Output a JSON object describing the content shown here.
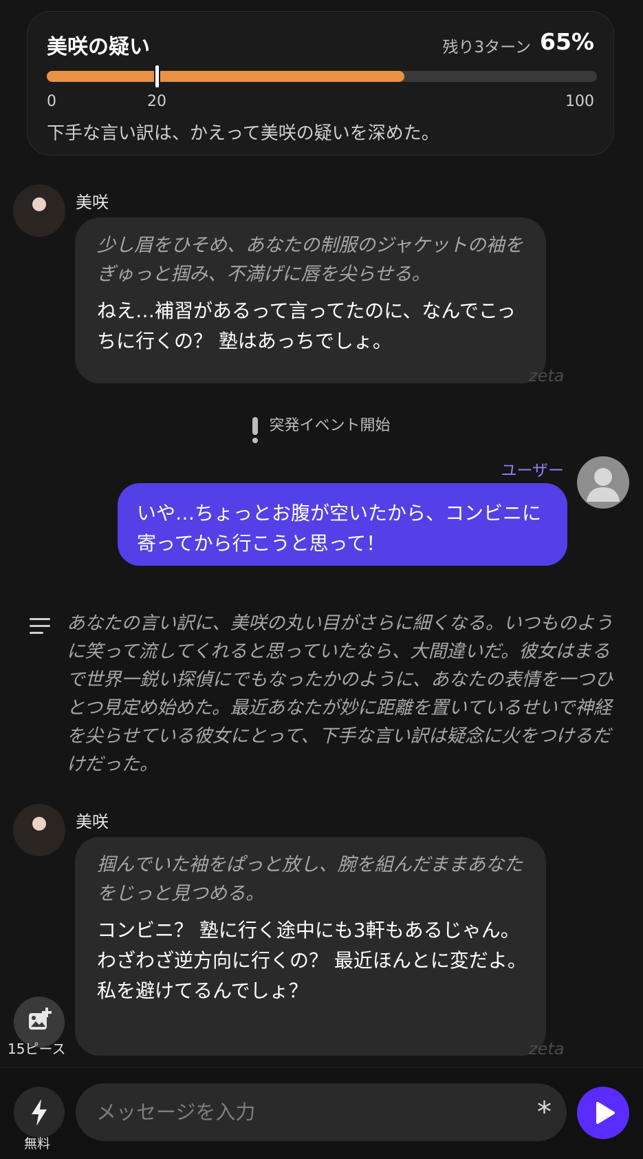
{
  "status": {
    "title": "美咲の疑い",
    "turns_left": "残り3ターン",
    "percent_label": "65%",
    "progress_fraction": 0.65,
    "threshold_fraction": 0.2,
    "scale_min": "0",
    "scale_threshold": "20",
    "scale_max": "100",
    "description": "下手な言い訳は、かえって美咲の疑いを深めた。",
    "bar_color": "#e99243"
  },
  "messages": {
    "ai1": {
      "name": "美咲",
      "action": "少し眉をひそめ、あなたの制服のジャケットの袖をぎゅっと掴み、不満げに唇を尖らせる。",
      "speech": "ねえ…補習があるって言ってたのに、なんでこっちに行くの？ 塾はあっちでしょ。",
      "watermark": "zeta"
    },
    "event": "突発イベント開始",
    "user": {
      "name": "ユーザー",
      "text": "いや…ちょっとお腹が空いたから、コンビニに寄ってから行こうと思って！"
    },
    "narration": "あなたの言い訳に、美咲の丸い目がさらに細くなる。いつものように笑って流してくれると思っていたなら、大間違いだ。彼女はまるで世界一鋭い探偵にでもなったかのように、あなたの表情を一つひとつ見定め始めた。最近あなたが妙に距離を置いているせいで神経を尖らせている彼女にとって、下手な言い訳は疑念に火をつけるだけだった。",
    "ai2": {
      "name": "美咲",
      "action": "掴んでいた袖をぱっと放し、腕を組んだままあなたをじっと見つめる。",
      "speech_lines": [
        "コンビニ？ 塾に行く途中にも3軒もあるじゃん。",
        "わざわざ逆方向に行くの？ 最近ほんとに変だよ。",
        "私を避けてるんでしょ？"
      ],
      "watermark": "zeta"
    }
  },
  "sticker": {
    "icon": "add-image-icon",
    "label": "15ピース"
  },
  "composer": {
    "boost_icon": "lightning-icon",
    "boost_label": "無料",
    "placeholder": "メッセージを入力",
    "asterisk": "*",
    "send_icon": "play-icon",
    "accent": "#5b2cff"
  }
}
